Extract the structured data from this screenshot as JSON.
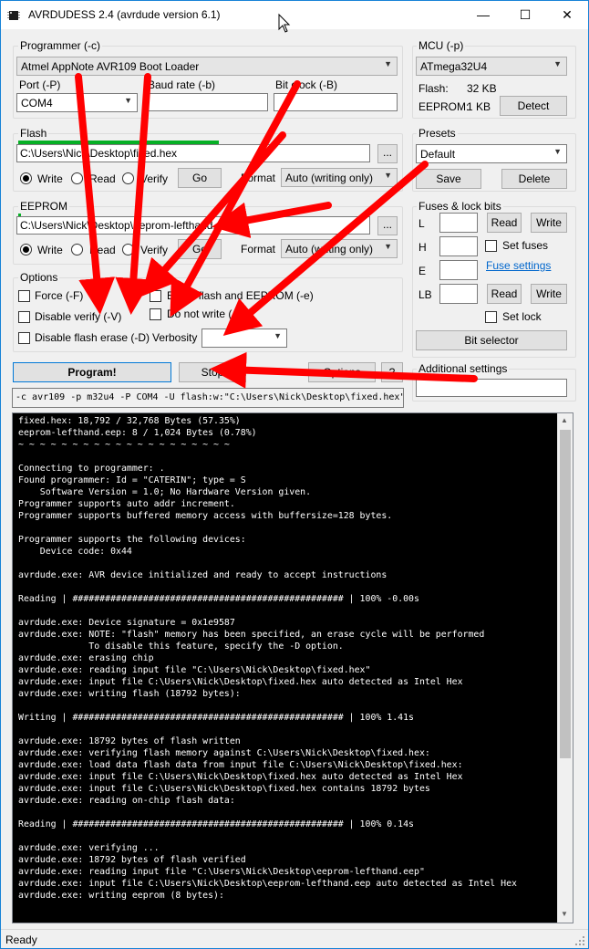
{
  "window": {
    "title": "AVRDUDESS 2.4 (avrdude version 6.1)",
    "minimize": "—",
    "maximize": "☐",
    "close": "✕"
  },
  "programmer": {
    "group_label": "Programmer (-c)",
    "selected": "Atmel AppNote AVR109 Boot Loader",
    "port_label": "Port (-P)",
    "port_value": "COM4",
    "baud_label": "Baud rate (-b)",
    "baud_value": "",
    "bitclock_label": "Bit clock (-B)",
    "bitclock_value": ""
  },
  "mcu": {
    "group_label": "MCU (-p)",
    "selected": "ATmega32U4",
    "flash_label": "Flash:",
    "flash_value": "32 KB",
    "eeprom_label": "EEPROM:",
    "eeprom_value": "1 KB",
    "detect": "Detect"
  },
  "flash": {
    "group_label": "Flash",
    "path": "C:\\Users\\Nick\\Desktop\\fixed.hex",
    "browse": "...",
    "write": "Write",
    "read": "Read",
    "verify": "Verify",
    "go": "Go",
    "format_label": "Format",
    "format_value": "Auto (writing only)"
  },
  "presets": {
    "group_label": "Presets",
    "selected": "Default",
    "save": "Save",
    "delete": "Delete"
  },
  "eeprom": {
    "group_label": "EEPROM",
    "path": "C:\\Users\\Nick\\Desktop\\eeprom-lefthand.eep",
    "browse": "...",
    "write": "Write",
    "read": "Read",
    "verify": "Verify",
    "go": "Go",
    "format_label": "Format",
    "format_value": "Auto (writing only)"
  },
  "fuses": {
    "group_label": "Fuses & lock bits",
    "l_label": "L",
    "h_label": "H",
    "e_label": "E",
    "lb_label": "LB",
    "read": "Read",
    "write": "Write",
    "set_fuses": "Set fuses",
    "fuse_settings": "Fuse settings",
    "set_lock": "Set lock",
    "bit_selector": "Bit selector"
  },
  "options": {
    "group_label": "Options",
    "force": "Force (-F)",
    "disable_verify": "Disable verify (-V)",
    "disable_flash_erase": "Disable flash erase (-D)",
    "erase": "Erase flash and EEPROM (-e)",
    "do_not_write": "Do not write (-n)",
    "verbosity_label": "Verbosity",
    "verbosity_value": ""
  },
  "actions": {
    "program": "Program!",
    "stop": "Stop",
    "options": "Options",
    "help": "?"
  },
  "additional": {
    "label": "Additional settings",
    "value": ""
  },
  "command": "-c avr109 -p m32u4 -P COM4 -U flash:w:\"C:\\Users\\Nick\\Desktop\\fixed.hex\"",
  "console": {
    "text": "fixed.hex: 18,792 / 32,768 Bytes (57.35%)\neeprom-lefthand.eep: 8 / 1,024 Bytes (0.78%)\n~ ~ ~ ~ ~ ~ ~ ~ ~ ~ ~ ~ ~ ~ ~ ~ ~ ~ ~ ~\n\nConnecting to programmer: .\nFound programmer: Id = \"CATERIN\"; type = S\n    Software Version = 1.0; No Hardware Version given.\nProgrammer supports auto addr increment.\nProgrammer supports buffered memory access with buffersize=128 bytes.\n\nProgrammer supports the following devices:\n    Device code: 0x44\n\navrdude.exe: AVR device initialized and ready to accept instructions\n\nReading | ################################################## | 100% -0.00s\n\navrdude.exe: Device signature = 0x1e9587\navrdude.exe: NOTE: \"flash\" memory has been specified, an erase cycle will be performed\n             To disable this feature, specify the -D option.\navrdude.exe: erasing chip\navrdude.exe: reading input file \"C:\\Users\\Nick\\Desktop\\fixed.hex\"\navrdude.exe: input file C:\\Users\\Nick\\Desktop\\fixed.hex auto detected as Intel Hex\navrdude.exe: writing flash (18792 bytes):\n\nWriting | ################################################## | 100% 1.41s\n\navrdude.exe: 18792 bytes of flash written\navrdude.exe: verifying flash memory against C:\\Users\\Nick\\Desktop\\fixed.hex:\navrdude.exe: load data flash data from input file C:\\Users\\Nick\\Desktop\\fixed.hex:\navrdude.exe: input file C:\\Users\\Nick\\Desktop\\fixed.hex auto detected as Intel Hex\navrdude.exe: input file C:\\Users\\Nick\\Desktop\\fixed.hex contains 18792 bytes\navrdude.exe: reading on-chip flash data:\n\nReading | ################################################## | 100% 0.14s\n\navrdude.exe: verifying ...\navrdude.exe: 18792 bytes of flash verified\navrdude.exe: reading input file \"C:\\Users\\Nick\\Desktop\\eeprom-lefthand.eep\"\navrdude.exe: input file C:\\Users\\Nick\\Desktop\\eeprom-lefthand.eep auto detected as Intel Hex\navrdude.exe: writing eeprom (8 bytes):"
  },
  "status": "Ready",
  "colors": {
    "arrow": "#ff0000",
    "title_border": "#1883d7",
    "link": "#0066cc",
    "progress": "#06b025"
  },
  "icons": {
    "app": "avrdudess-chip-icon",
    "scroll_up": "▲",
    "scroll_down": "▼",
    "dropdown": "▼"
  }
}
